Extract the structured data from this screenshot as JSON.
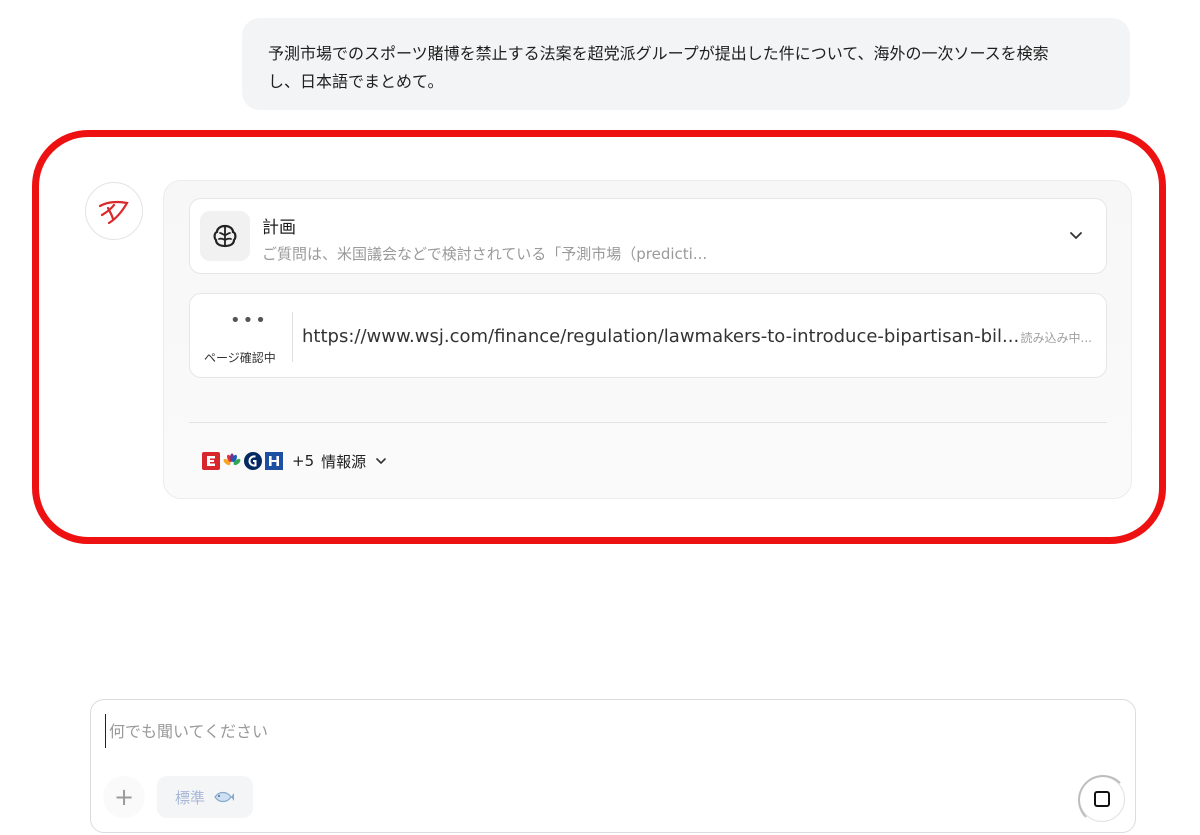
{
  "user_message": {
    "line1": "予測市場でのスポーツ賭博を禁止する法案を超党派グループが提出した件について、海外の一次ソースを検索",
    "line2": "し、日本語でまとめて。"
  },
  "assistant": {
    "avatar_icon": "swirl-logo-icon",
    "plan": {
      "title": "計画",
      "subtitle": "ご質問は、米国議会などで検討されている「予測市場（predicti...",
      "icon": "brain-icon"
    },
    "page_check": {
      "dots": "•••",
      "status": "ページ確認中",
      "url": "https://www.wsj.com/finance/regulation/lawmakers-to-introduce-bipartisan-bil...",
      "loading": "読み込み中..."
    },
    "sources": {
      "extra_count": "+5",
      "label": "情報源",
      "icons": [
        "espn-icon",
        "nbc-peacock-icon",
        "guardian-icon",
        "hill-icon"
      ]
    }
  },
  "composer": {
    "placeholder": "何でも聞いてください",
    "plus_label": "+",
    "mode_label": "標準"
  },
  "colors": {
    "highlight": "#ee1111",
    "avatar_red": "#d9292b"
  }
}
